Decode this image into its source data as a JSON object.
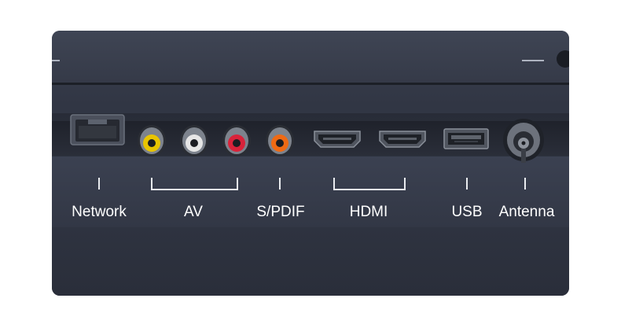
{
  "ports": {
    "network_label": "Network",
    "av_label": "AV",
    "spdif_label": "S/PDIF",
    "hdmi_label": "HDMI",
    "usb_label": "USB",
    "antenna_label": "Antenna"
  },
  "colors": {
    "panel": "#313644",
    "av_yellow": "#e8c400",
    "av_white": "#e6e6e6",
    "av_red": "#d9233a",
    "spdif_orange": "#ef6a14",
    "label": "#ffffff"
  },
  "icons": [
    "ethernet-port-icon",
    "rca-yellow-jack-icon",
    "rca-white-jack-icon",
    "rca-red-jack-icon",
    "optical-coax-jack-icon",
    "hdmi-port-icon",
    "usb-port-icon",
    "antenna-coax-icon"
  ]
}
